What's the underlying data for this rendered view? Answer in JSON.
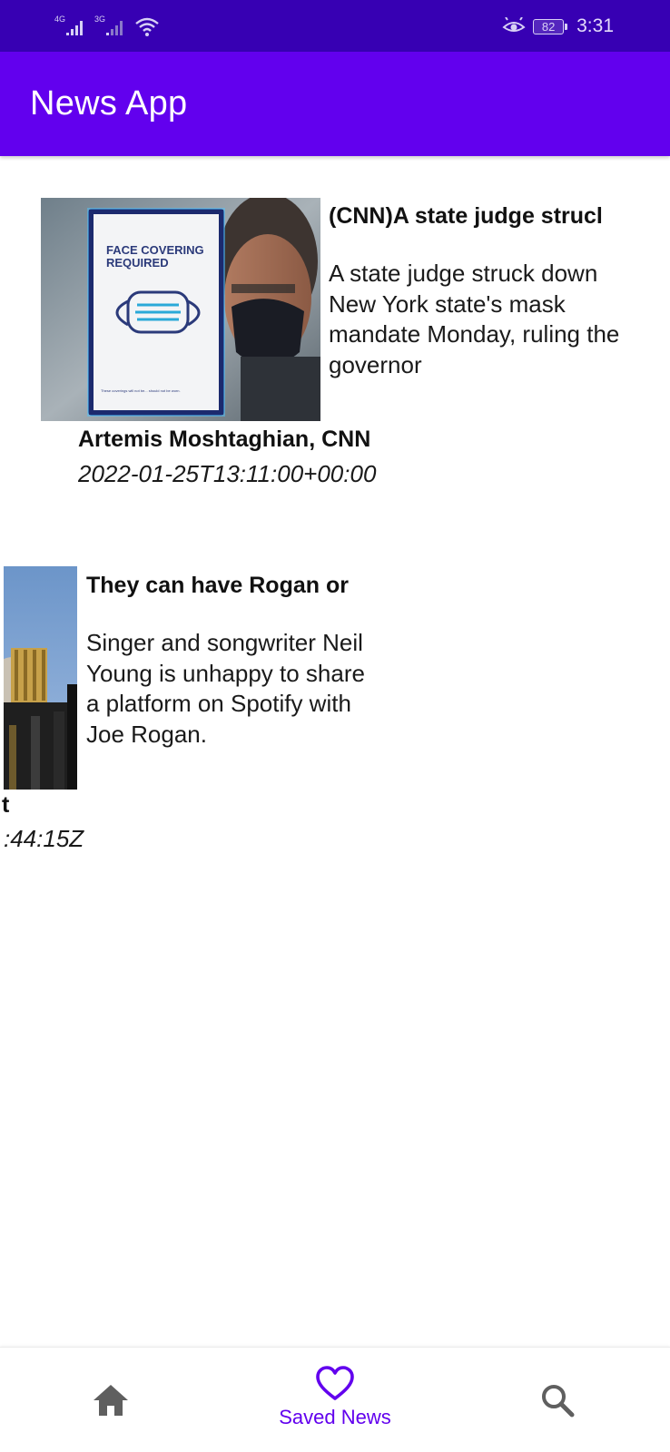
{
  "status_bar": {
    "network_1": "4G",
    "network_2": "3G",
    "battery": "82",
    "time": "3:31",
    "icons": [
      "signal-icon",
      "signal-icon",
      "wifi-icon",
      "eye-comfort-icon",
      "battery-icon"
    ]
  },
  "app_bar": {
    "title": "News App"
  },
  "articles": [
    {
      "title": "(CNN)A state judge strucl",
      "description": "A state judge struck down New York state's mask mandate Monday, ruling the governor",
      "author": "Artemis Moshtaghian, CNN",
      "published": "2022-01-25T13:11:00+00:00",
      "image_sign_line1": "FACE COVERING",
      "image_sign_line2": "REQUIRED",
      "image_sign_footer": "These coverings will not be... should not be worn."
    },
    {
      "title": "They can have Rogan or",
      "description": "Singer and songwriter Neil Young is unhappy to share a platform on Spotify with Joe Rogan.",
      "author": "t",
      "published": ":44:15Z"
    }
  ],
  "bottom_nav": {
    "home_icon": "home-icon",
    "saved_label": "Saved News",
    "saved_icon": "heart-icon",
    "search_icon": "search-icon",
    "active": "saved"
  },
  "colors": {
    "status_bar": "#3700b3",
    "primary": "#6200ee",
    "inactive_icon": "#5f5f5f"
  }
}
